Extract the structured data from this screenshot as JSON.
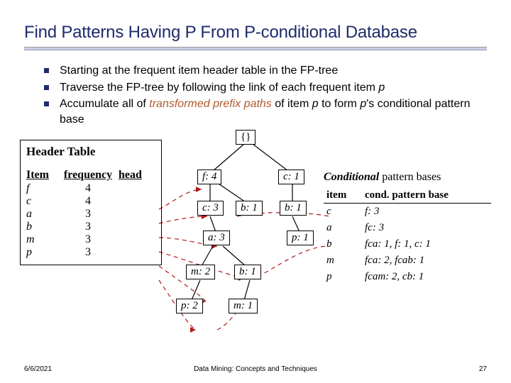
{
  "title": "Find Patterns Having P From P-conditional Database",
  "bullets": [
    {
      "text_a": "Starting at the frequent item header table in the FP-tree",
      "text_b": "",
      "text_c": ""
    },
    {
      "text_a": "Traverse the FP-tree by following the link of each frequent item ",
      "text_b": "p",
      "text_c": ""
    },
    {
      "text_a": "Accumulate all of ",
      "text_b": "transformed prefix paths",
      "text_c": " of item ",
      "text_d": "p",
      "text_e": " to form ",
      "text_f": "p",
      "text_g": "'s conditional pattern base"
    }
  ],
  "header_table": {
    "title": "Header Table",
    "cols": [
      "Item",
      "frequency",
      "head"
    ],
    "rows": [
      {
        "item": "f",
        "freq": "4",
        "head": ""
      },
      {
        "item": "c",
        "freq": "4",
        "head": ""
      },
      {
        "item": "a",
        "freq": "3",
        "head": ""
      },
      {
        "item": "b",
        "freq": "3",
        "head": ""
      },
      {
        "item": "m",
        "freq": "3",
        "head": ""
      },
      {
        "item": "p",
        "freq": "3",
        "head": ""
      }
    ]
  },
  "tree": {
    "root": "{}",
    "nodes": {
      "f4": "f: 4",
      "c1r": "c: 1",
      "c3": "c: 3",
      "b1a": "b: 1",
      "b1b": "b: 1",
      "a3": "a: 3",
      "p1": "p: 1",
      "m2": "m: 2",
      "b1c": "b: 1",
      "p2": "p: 2",
      "m1": "m: 1"
    }
  },
  "cpb": {
    "title_bold": "Conditional",
    "title_rest": " pattern bases",
    "cols": [
      "item",
      "cond. pattern base"
    ],
    "rows": [
      {
        "item": "c",
        "base": "f: 3"
      },
      {
        "item": "a",
        "base": "fc: 3"
      },
      {
        "item": "b",
        "base": "fca: 1, f: 1, c: 1"
      },
      {
        "item": "m",
        "base": "fca: 2, fcab: 1"
      },
      {
        "item": "p",
        "base": "fcam: 2, cb: 1"
      }
    ]
  },
  "footer": {
    "date": "6/6/2021",
    "mid": "Data Mining: Concepts and Techniques",
    "page": "27"
  },
  "colors": {
    "title": "#1f2b6b",
    "accent": "#b05a2d",
    "dash": "#b11a1a"
  },
  "chart_data": {
    "type": "table",
    "description": "FP-tree header table and conditional pattern bases for item p",
    "header_table": [
      {
        "item": "f",
        "frequency": 4
      },
      {
        "item": "c",
        "frequency": 4
      },
      {
        "item": "a",
        "frequency": 3
      },
      {
        "item": "b",
        "frequency": 3
      },
      {
        "item": "m",
        "frequency": 3
      },
      {
        "item": "p",
        "frequency": 3
      }
    ],
    "fp_tree_edges": [
      [
        "{}",
        "f:4"
      ],
      [
        "{}",
        "c:1"
      ],
      [
        "f:4",
        "c:3"
      ],
      [
        "f:4",
        "b:1"
      ],
      [
        "c:1",
        "b:1"
      ],
      [
        "c:3",
        "a:3"
      ],
      [
        "b:1(c:1)",
        "p:1"
      ],
      [
        "a:3",
        "m:2"
      ],
      [
        "a:3",
        "b:1"
      ],
      [
        "m:2",
        "p:2"
      ],
      [
        "b:1(a:3)",
        "m:1"
      ]
    ],
    "conditional_pattern_bases": {
      "c": [
        {
          "prefix": "f",
          "count": 3
        }
      ],
      "a": [
        {
          "prefix": "fc",
          "count": 3
        }
      ],
      "b": [
        {
          "prefix": "fca",
          "count": 1
        },
        {
          "prefix": "f",
          "count": 1
        },
        {
          "prefix": "c",
          "count": 1
        }
      ],
      "m": [
        {
          "prefix": "fca",
          "count": 2
        },
        {
          "prefix": "fcab",
          "count": 1
        }
      ],
      "p": [
        {
          "prefix": "fcam",
          "count": 2
        },
        {
          "prefix": "cb",
          "count": 1
        }
      ]
    }
  }
}
